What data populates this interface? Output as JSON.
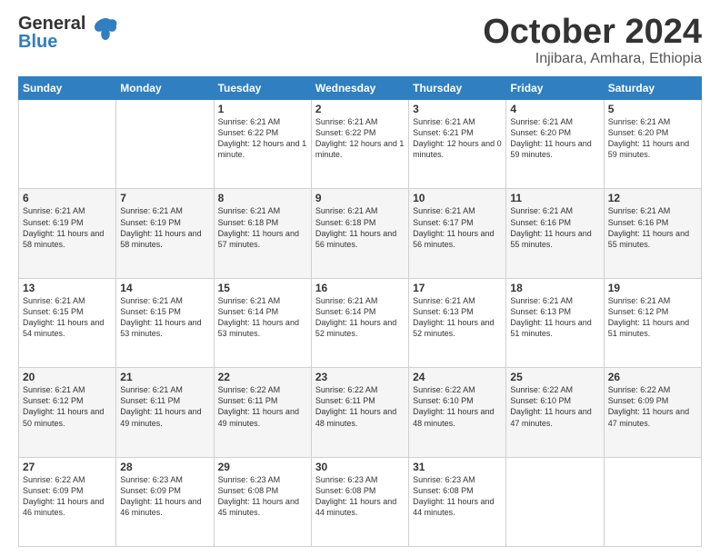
{
  "logo": {
    "line1": "General",
    "line2": "Blue"
  },
  "title": "October 2024",
  "subtitle": "Injibara, Amhara, Ethiopia",
  "days": [
    "Sunday",
    "Monday",
    "Tuesday",
    "Wednesday",
    "Thursday",
    "Friday",
    "Saturday"
  ],
  "weeks": [
    [
      {
        "day": "",
        "info": ""
      },
      {
        "day": "",
        "info": ""
      },
      {
        "day": "1",
        "info": "Sunrise: 6:21 AM\nSunset: 6:22 PM\nDaylight: 12 hours and 1 minute."
      },
      {
        "day": "2",
        "info": "Sunrise: 6:21 AM\nSunset: 6:22 PM\nDaylight: 12 hours and 1 minute."
      },
      {
        "day": "3",
        "info": "Sunrise: 6:21 AM\nSunset: 6:21 PM\nDaylight: 12 hours and 0 minutes."
      },
      {
        "day": "4",
        "info": "Sunrise: 6:21 AM\nSunset: 6:20 PM\nDaylight: 11 hours and 59 minutes."
      },
      {
        "day": "5",
        "info": "Sunrise: 6:21 AM\nSunset: 6:20 PM\nDaylight: 11 hours and 59 minutes."
      }
    ],
    [
      {
        "day": "6",
        "info": "Sunrise: 6:21 AM\nSunset: 6:19 PM\nDaylight: 11 hours and 58 minutes."
      },
      {
        "day": "7",
        "info": "Sunrise: 6:21 AM\nSunset: 6:19 PM\nDaylight: 11 hours and 58 minutes."
      },
      {
        "day": "8",
        "info": "Sunrise: 6:21 AM\nSunset: 6:18 PM\nDaylight: 11 hours and 57 minutes."
      },
      {
        "day": "9",
        "info": "Sunrise: 6:21 AM\nSunset: 6:18 PM\nDaylight: 11 hours and 56 minutes."
      },
      {
        "day": "10",
        "info": "Sunrise: 6:21 AM\nSunset: 6:17 PM\nDaylight: 11 hours and 56 minutes."
      },
      {
        "day": "11",
        "info": "Sunrise: 6:21 AM\nSunset: 6:16 PM\nDaylight: 11 hours and 55 minutes."
      },
      {
        "day": "12",
        "info": "Sunrise: 6:21 AM\nSunset: 6:16 PM\nDaylight: 11 hours and 55 minutes."
      }
    ],
    [
      {
        "day": "13",
        "info": "Sunrise: 6:21 AM\nSunset: 6:15 PM\nDaylight: 11 hours and 54 minutes."
      },
      {
        "day": "14",
        "info": "Sunrise: 6:21 AM\nSunset: 6:15 PM\nDaylight: 11 hours and 53 minutes."
      },
      {
        "day": "15",
        "info": "Sunrise: 6:21 AM\nSunset: 6:14 PM\nDaylight: 11 hours and 53 minutes."
      },
      {
        "day": "16",
        "info": "Sunrise: 6:21 AM\nSunset: 6:14 PM\nDaylight: 11 hours and 52 minutes."
      },
      {
        "day": "17",
        "info": "Sunrise: 6:21 AM\nSunset: 6:13 PM\nDaylight: 11 hours and 52 minutes."
      },
      {
        "day": "18",
        "info": "Sunrise: 6:21 AM\nSunset: 6:13 PM\nDaylight: 11 hours and 51 minutes."
      },
      {
        "day": "19",
        "info": "Sunrise: 6:21 AM\nSunset: 6:12 PM\nDaylight: 11 hours and 51 minutes."
      }
    ],
    [
      {
        "day": "20",
        "info": "Sunrise: 6:21 AM\nSunset: 6:12 PM\nDaylight: 11 hours and 50 minutes."
      },
      {
        "day": "21",
        "info": "Sunrise: 6:21 AM\nSunset: 6:11 PM\nDaylight: 11 hours and 49 minutes."
      },
      {
        "day": "22",
        "info": "Sunrise: 6:22 AM\nSunset: 6:11 PM\nDaylight: 11 hours and 49 minutes."
      },
      {
        "day": "23",
        "info": "Sunrise: 6:22 AM\nSunset: 6:11 PM\nDaylight: 11 hours and 48 minutes."
      },
      {
        "day": "24",
        "info": "Sunrise: 6:22 AM\nSunset: 6:10 PM\nDaylight: 11 hours and 48 minutes."
      },
      {
        "day": "25",
        "info": "Sunrise: 6:22 AM\nSunset: 6:10 PM\nDaylight: 11 hours and 47 minutes."
      },
      {
        "day": "26",
        "info": "Sunrise: 6:22 AM\nSunset: 6:09 PM\nDaylight: 11 hours and 47 minutes."
      }
    ],
    [
      {
        "day": "27",
        "info": "Sunrise: 6:22 AM\nSunset: 6:09 PM\nDaylight: 11 hours and 46 minutes."
      },
      {
        "day": "28",
        "info": "Sunrise: 6:23 AM\nSunset: 6:09 PM\nDaylight: 11 hours and 46 minutes."
      },
      {
        "day": "29",
        "info": "Sunrise: 6:23 AM\nSunset: 6:08 PM\nDaylight: 11 hours and 45 minutes."
      },
      {
        "day": "30",
        "info": "Sunrise: 6:23 AM\nSunset: 6:08 PM\nDaylight: 11 hours and 44 minutes."
      },
      {
        "day": "31",
        "info": "Sunrise: 6:23 AM\nSunset: 6:08 PM\nDaylight: 11 hours and 44 minutes."
      },
      {
        "day": "",
        "info": ""
      },
      {
        "day": "",
        "info": ""
      }
    ]
  ]
}
